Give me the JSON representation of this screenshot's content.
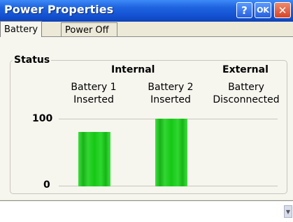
{
  "window": {
    "title": "Power Properties",
    "help_label": "?",
    "ok_label": "OK",
    "close_label": "✕"
  },
  "tabs": [
    {
      "label": "Battery"
    },
    {
      "label": "Power Off"
    }
  ],
  "group": {
    "label": "Status"
  },
  "columns": {
    "internal_header": "Internal",
    "external_header": "External",
    "battery1": {
      "name": "Battery 1",
      "status": "Inserted"
    },
    "battery2": {
      "name": "Battery 2",
      "status": "Inserted"
    },
    "external": {
      "name": "Battery",
      "status": "Disconnected"
    }
  },
  "chart_data": {
    "type": "bar",
    "categories": [
      "Battery 1",
      "Battery 2",
      "Battery"
    ],
    "values": [
      80,
      100,
      0
    ],
    "ylim": [
      0,
      100
    ],
    "yticks": [
      "100",
      "0"
    ],
    "colors": {
      "bar": "#22cc22"
    }
  }
}
